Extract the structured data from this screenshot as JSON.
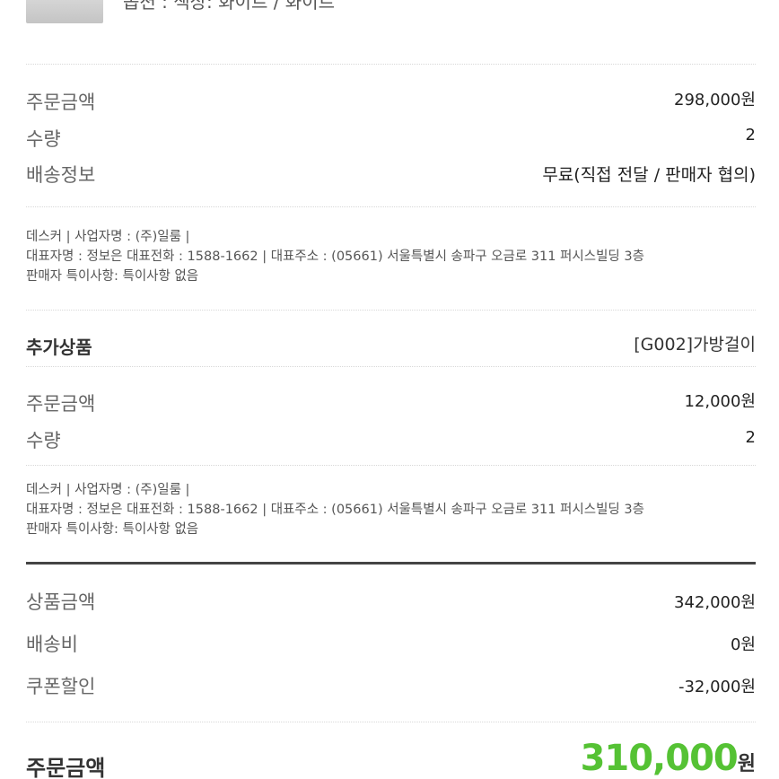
{
  "product": {
    "option_text": "옵션 : 색상: 화이트 / 화이트"
  },
  "main_item": {
    "order_amount_label": "주문금액",
    "order_amount_value": "298,000원",
    "quantity_label": "수량",
    "quantity_value": "2",
    "shipping_label": "배송정보",
    "shipping_value": "무료(직접 전달 / 판매자 협의)"
  },
  "seller_block_1": {
    "line1": "데스커 | 사업자명 : (주)일룸 |",
    "line2": "대표자명 : 정보은 대표전화 : 1588-1662 | 대표주소 : (05661) 서울특별시 송파구 오금로 311 퍼시스빌딩 3층",
    "line3": "판매자 특이사항: 특이사항 없음"
  },
  "addon": {
    "section_title": "추가상품",
    "name": "[G002]가방걸이",
    "order_amount_label": "주문금액",
    "order_amount_value": "12,000원",
    "quantity_label": "수량",
    "quantity_value": "2"
  },
  "seller_block_2": {
    "line1": "데스커 | 사업자명 : (주)일룸 |",
    "line2": "대표자명 : 정보은 대표전화 : 1588-1662 | 대표주소 : (05661) 서울특별시 송파구 오금로 311 퍼시스빌딩 3층",
    "line3": "판매자 특이사항: 특이사항 없음"
  },
  "summary": {
    "product_amount_label": "상품금액",
    "product_amount_value": "342,000원",
    "shipping_fee_label": "배송비",
    "shipping_fee_value": "0원",
    "coupon_label": "쿠폰할인",
    "coupon_value": "-32,000원",
    "total_label": "주문금액",
    "total_number": "310,000",
    "total_unit": "원"
  },
  "colors": {
    "total_accent": "#55c234",
    "divider": "#444444"
  }
}
